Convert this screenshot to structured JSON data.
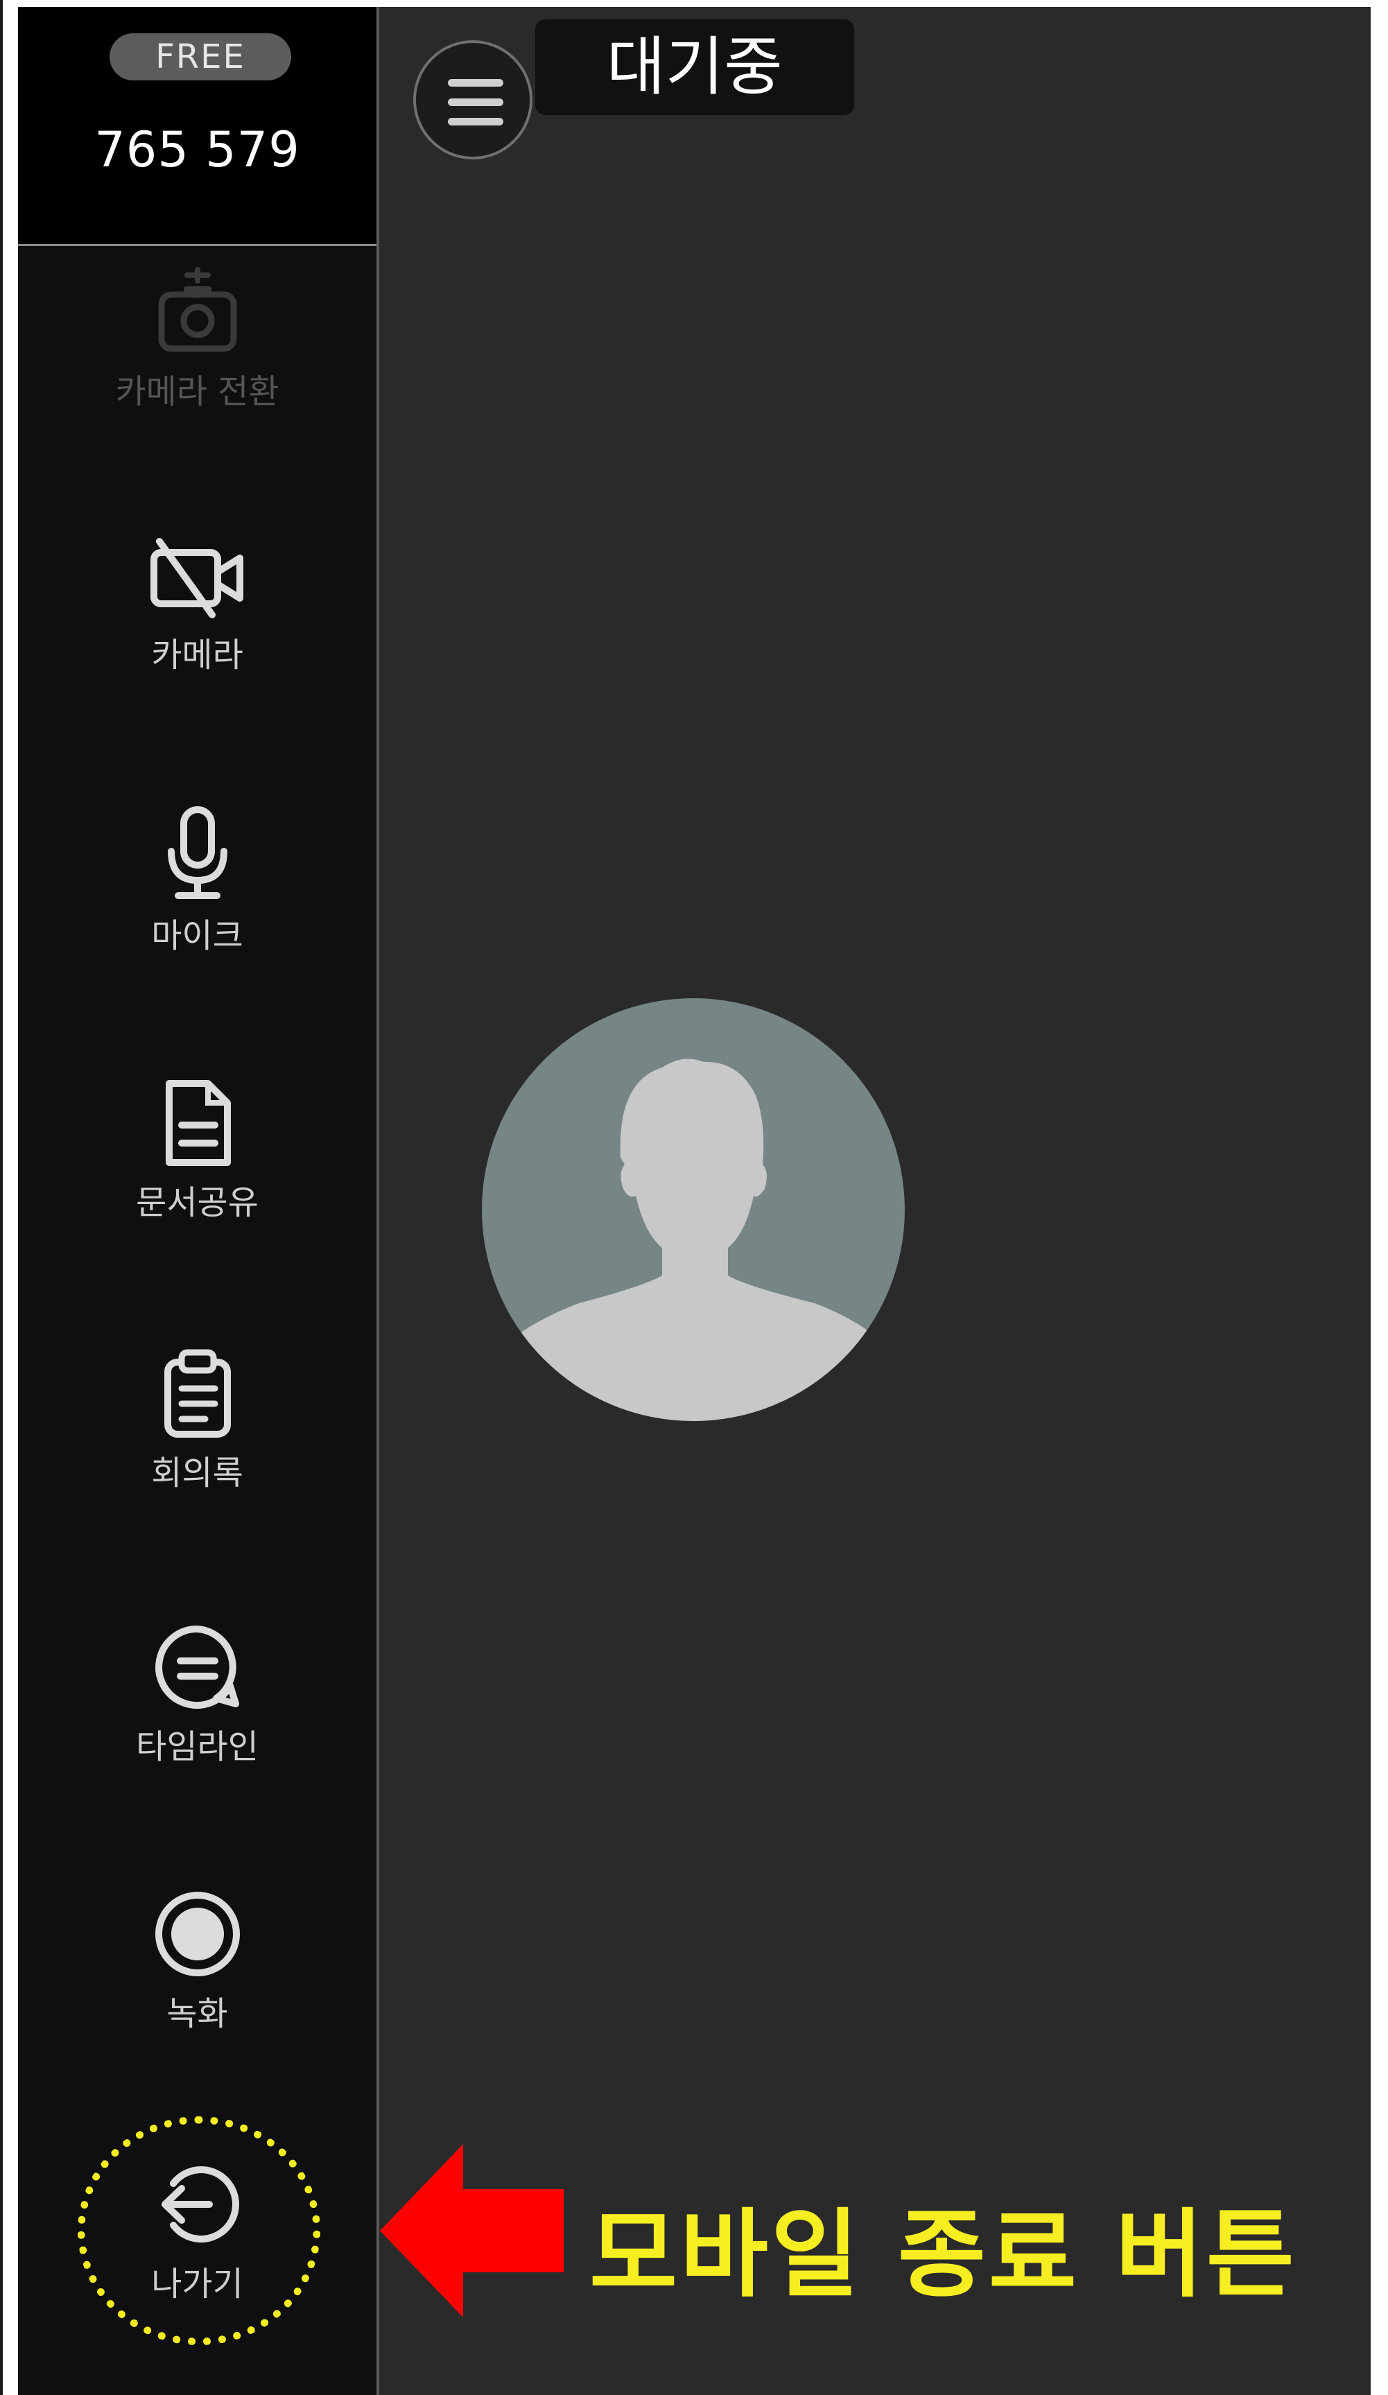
{
  "sidebar": {
    "plan_badge": "FREE",
    "meeting_id": "765 579",
    "tools": [
      {
        "label": "카메라 전환",
        "icon": "camera-switch-icon"
      },
      {
        "label": "카메라",
        "icon": "camera-off-icon"
      },
      {
        "label": "마이크",
        "icon": "microphone-icon"
      },
      {
        "label": "문서공유",
        "icon": "document-icon"
      },
      {
        "label": "회의록",
        "icon": "clipboard-icon"
      },
      {
        "label": "타임라인",
        "icon": "chat-bubble-icon"
      },
      {
        "label": "녹화",
        "icon": "record-icon"
      },
      {
        "label": "나가기",
        "icon": "exit-icon"
      }
    ]
  },
  "header": {
    "status": "대기중",
    "menu_icon": "hamburger-menu-icon"
  },
  "main": {
    "participant_avatar": "user-silhouette-icon"
  },
  "annotation": {
    "callout_text": "모바일 종료 버튼",
    "highlight_color": "#f7ee22",
    "arrow_color": "#ff0000"
  }
}
